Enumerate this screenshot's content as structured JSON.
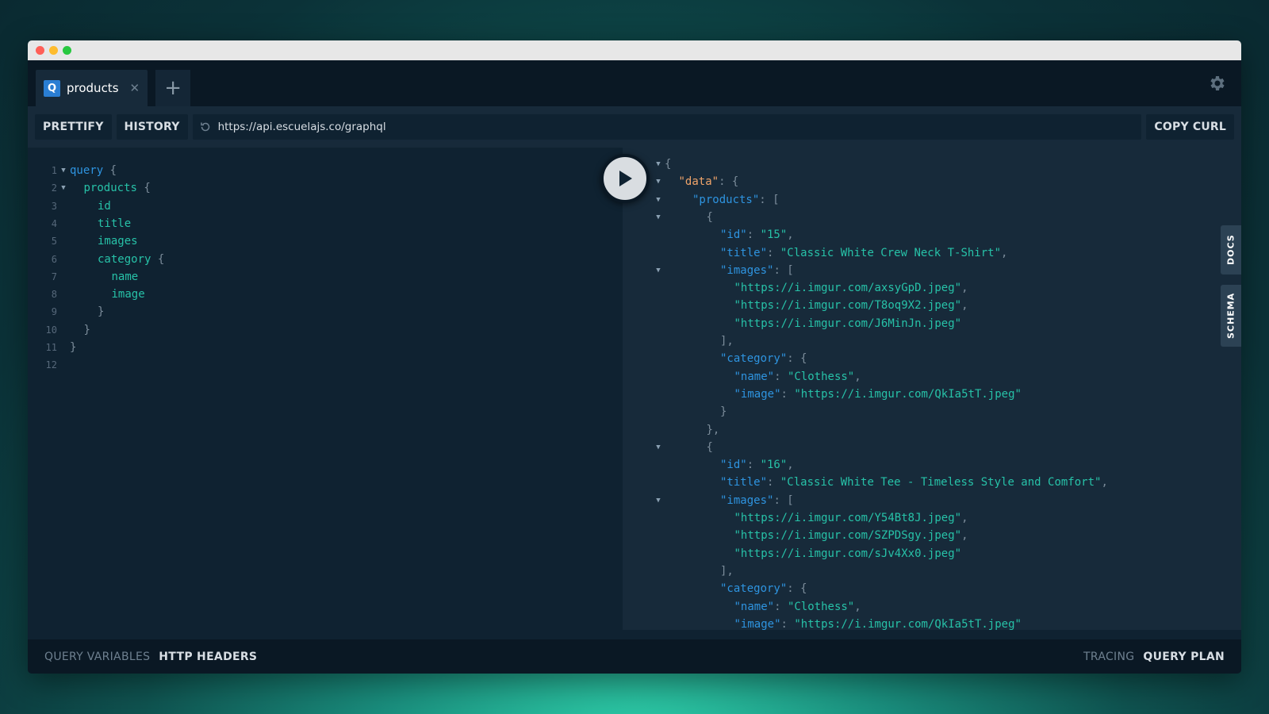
{
  "tab": {
    "badge": "Q",
    "label": "products",
    "close_glyph": "✕",
    "add_glyph": "+"
  },
  "toolbar": {
    "prettify": "PRETTIFY",
    "history": "HISTORY",
    "url": "https://api.escuelajs.co/graphql",
    "copy_curl": "COPY CURL"
  },
  "editor": {
    "lines": [
      {
        "n": "1",
        "fold": true,
        "indent": 0,
        "parts": [
          [
            "kw",
            "query"
          ],
          [
            "punct",
            " {"
          ]
        ]
      },
      {
        "n": "2",
        "fold": true,
        "indent": 1,
        "parts": [
          [
            "field",
            "products"
          ],
          [
            "punct",
            " {"
          ]
        ]
      },
      {
        "n": "3",
        "fold": false,
        "indent": 2,
        "parts": [
          [
            "field",
            "id"
          ]
        ]
      },
      {
        "n": "4",
        "fold": false,
        "indent": 2,
        "parts": [
          [
            "field",
            "title"
          ]
        ]
      },
      {
        "n": "5",
        "fold": false,
        "indent": 2,
        "parts": [
          [
            "field",
            "images"
          ]
        ]
      },
      {
        "n": "6",
        "fold": false,
        "indent": 2,
        "parts": [
          [
            "field",
            "category"
          ],
          [
            "punct",
            " {"
          ]
        ]
      },
      {
        "n": "7",
        "fold": false,
        "indent": 3,
        "parts": [
          [
            "field",
            "name"
          ]
        ]
      },
      {
        "n": "8",
        "fold": false,
        "indent": 3,
        "parts": [
          [
            "field",
            "image"
          ]
        ]
      },
      {
        "n": "9",
        "fold": false,
        "indent": 2,
        "parts": [
          [
            "punct",
            "}"
          ]
        ]
      },
      {
        "n": "10",
        "fold": false,
        "indent": 1,
        "parts": [
          [
            "punct",
            "}"
          ]
        ]
      },
      {
        "n": "11",
        "fold": false,
        "indent": 0,
        "parts": [
          [
            "punct",
            "}"
          ]
        ]
      },
      {
        "n": "12",
        "fold": false,
        "indent": 0,
        "parts": []
      }
    ]
  },
  "result": {
    "lines": [
      {
        "fold": true,
        "indent": 0,
        "parts": [
          [
            "punct",
            "{"
          ]
        ]
      },
      {
        "fold": true,
        "indent": 1,
        "parts": [
          [
            "data",
            "\"data\""
          ],
          [
            "punct",
            ": {"
          ]
        ]
      },
      {
        "fold": true,
        "indent": 2,
        "parts": [
          [
            "key",
            "\"products\""
          ],
          [
            "punct",
            ": ["
          ]
        ]
      },
      {
        "fold": true,
        "indent": 3,
        "parts": [
          [
            "punct",
            "{"
          ]
        ]
      },
      {
        "fold": false,
        "indent": 4,
        "parts": [
          [
            "key",
            "\"id\""
          ],
          [
            "punct",
            ": "
          ],
          [
            "str",
            "\"15\""
          ],
          [
            "punct",
            ","
          ]
        ]
      },
      {
        "fold": false,
        "indent": 4,
        "parts": [
          [
            "key",
            "\"title\""
          ],
          [
            "punct",
            ": "
          ],
          [
            "str",
            "\"Classic White Crew Neck T-Shirt\""
          ],
          [
            "punct",
            ","
          ]
        ]
      },
      {
        "fold": true,
        "indent": 4,
        "parts": [
          [
            "key",
            "\"images\""
          ],
          [
            "punct",
            ": ["
          ]
        ]
      },
      {
        "fold": false,
        "indent": 5,
        "parts": [
          [
            "str",
            "\"https://i.imgur.com/axsyGpD.jpeg\""
          ],
          [
            "punct",
            ","
          ]
        ]
      },
      {
        "fold": false,
        "indent": 5,
        "parts": [
          [
            "str",
            "\"https://i.imgur.com/T8oq9X2.jpeg\""
          ],
          [
            "punct",
            ","
          ]
        ]
      },
      {
        "fold": false,
        "indent": 5,
        "parts": [
          [
            "str",
            "\"https://i.imgur.com/J6MinJn.jpeg\""
          ]
        ]
      },
      {
        "fold": false,
        "indent": 4,
        "parts": [
          [
            "punct",
            "],"
          ]
        ]
      },
      {
        "fold": false,
        "indent": 4,
        "parts": [
          [
            "key",
            "\"category\""
          ],
          [
            "punct",
            ": {"
          ]
        ]
      },
      {
        "fold": false,
        "indent": 5,
        "parts": [
          [
            "key",
            "\"name\""
          ],
          [
            "punct",
            ": "
          ],
          [
            "str",
            "\"Clothess\""
          ],
          [
            "punct",
            ","
          ]
        ]
      },
      {
        "fold": false,
        "indent": 5,
        "parts": [
          [
            "key",
            "\"image\""
          ],
          [
            "punct",
            ": "
          ],
          [
            "str",
            "\"https://i.imgur.com/QkIa5tT.jpeg\""
          ]
        ]
      },
      {
        "fold": false,
        "indent": 4,
        "parts": [
          [
            "punct",
            "}"
          ]
        ]
      },
      {
        "fold": false,
        "indent": 3,
        "parts": [
          [
            "punct",
            "},"
          ]
        ]
      },
      {
        "fold": true,
        "indent": 3,
        "parts": [
          [
            "punct",
            "{"
          ]
        ]
      },
      {
        "fold": false,
        "indent": 4,
        "parts": [
          [
            "key",
            "\"id\""
          ],
          [
            "punct",
            ": "
          ],
          [
            "str",
            "\"16\""
          ],
          [
            "punct",
            ","
          ]
        ]
      },
      {
        "fold": false,
        "indent": 4,
        "parts": [
          [
            "key",
            "\"title\""
          ],
          [
            "punct",
            ": "
          ],
          [
            "str",
            "\"Classic White Tee - Timeless Style and Comfort\""
          ],
          [
            "punct",
            ","
          ]
        ]
      },
      {
        "fold": true,
        "indent": 4,
        "parts": [
          [
            "key",
            "\"images\""
          ],
          [
            "punct",
            ": ["
          ]
        ]
      },
      {
        "fold": false,
        "indent": 5,
        "parts": [
          [
            "str",
            "\"https://i.imgur.com/Y54Bt8J.jpeg\""
          ],
          [
            "punct",
            ","
          ]
        ]
      },
      {
        "fold": false,
        "indent": 5,
        "parts": [
          [
            "str",
            "\"https://i.imgur.com/SZPDSgy.jpeg\""
          ],
          [
            "punct",
            ","
          ]
        ]
      },
      {
        "fold": false,
        "indent": 5,
        "parts": [
          [
            "str",
            "\"https://i.imgur.com/sJv4Xx0.jpeg\""
          ]
        ]
      },
      {
        "fold": false,
        "indent": 4,
        "parts": [
          [
            "punct",
            "],"
          ]
        ]
      },
      {
        "fold": false,
        "indent": 4,
        "parts": [
          [
            "key",
            "\"category\""
          ],
          [
            "punct",
            ": {"
          ]
        ]
      },
      {
        "fold": false,
        "indent": 5,
        "parts": [
          [
            "key",
            "\"name\""
          ],
          [
            "punct",
            ": "
          ],
          [
            "str",
            "\"Clothess\""
          ],
          [
            "punct",
            ","
          ]
        ]
      },
      {
        "fold": false,
        "indent": 5,
        "parts": [
          [
            "key",
            "\"image\""
          ],
          [
            "punct",
            ": "
          ],
          [
            "str",
            "\"https://i.imgur.com/QkIa5tT.jpeg\""
          ]
        ]
      }
    ]
  },
  "side_tabs": {
    "docs": "DOCS",
    "schema": "SCHEMA"
  },
  "bottom": {
    "query_variables": "QUERY VARIABLES",
    "http_headers": "HTTP HEADERS",
    "tracing": "TRACING",
    "query_plan": "QUERY PLAN"
  },
  "icons": {
    "settings": "gear-icon",
    "refresh": "refresh-icon",
    "run": "play-icon"
  },
  "colors": {
    "keyword": "#2e94e0",
    "field": "#27c2a8",
    "data_key": "#f0a46a",
    "tab_badge": "#2a7ed3"
  }
}
